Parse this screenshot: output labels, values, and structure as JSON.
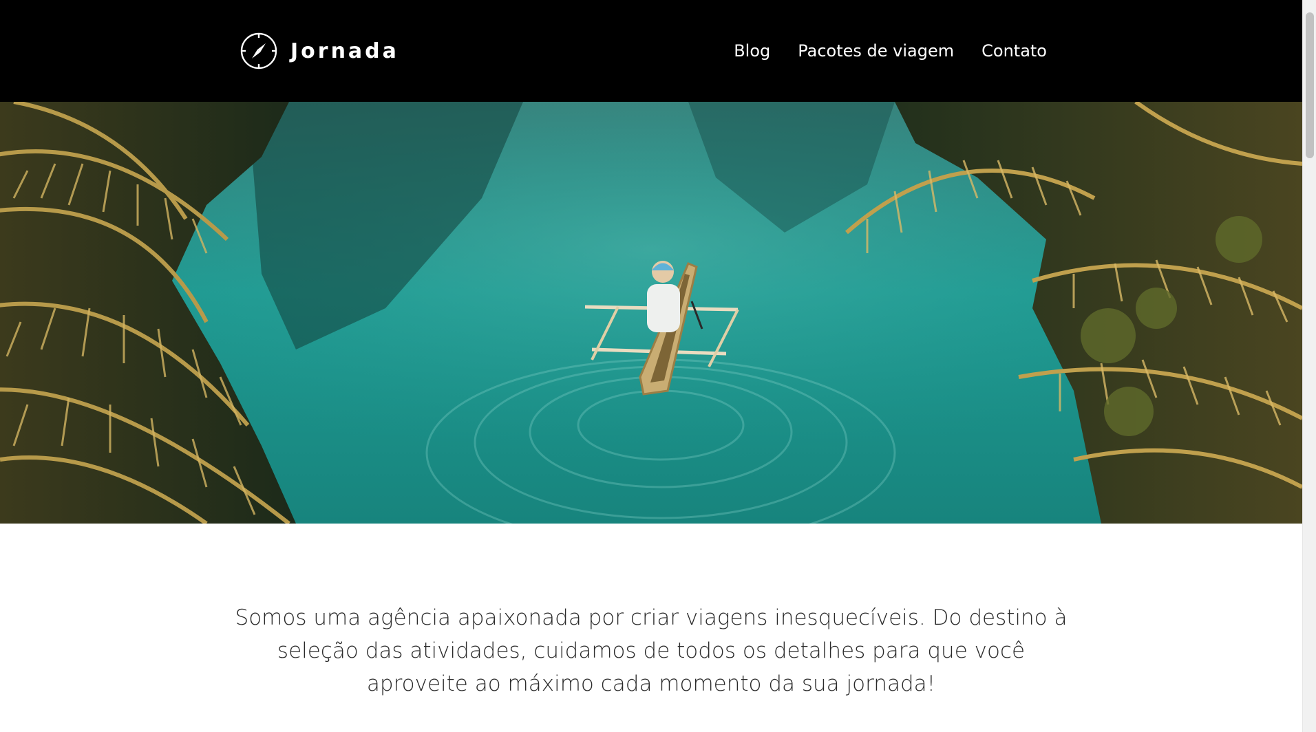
{
  "brand": {
    "name": "Jornada",
    "icon": "compass-icon"
  },
  "nav": {
    "items": [
      {
        "label": "Blog"
      },
      {
        "label": "Pacotes de viagem"
      },
      {
        "label": "Contato"
      }
    ]
  },
  "hero": {
    "scene": "aerial-river-canoe-photo"
  },
  "intro": {
    "text": "Somos uma agência apaixonada por criar viagens inesquecíveis. Do destino à seleção das atividades, cuidamos de todos os detalhes para que você aproveite ao máximo cada momento da sua jornada!"
  },
  "colors": {
    "header_bg": "#000000",
    "nav_text": "#ffffff",
    "water": "#1f9a92",
    "foliage": "#8a7a3a",
    "body_text": "#2a2a2a"
  }
}
